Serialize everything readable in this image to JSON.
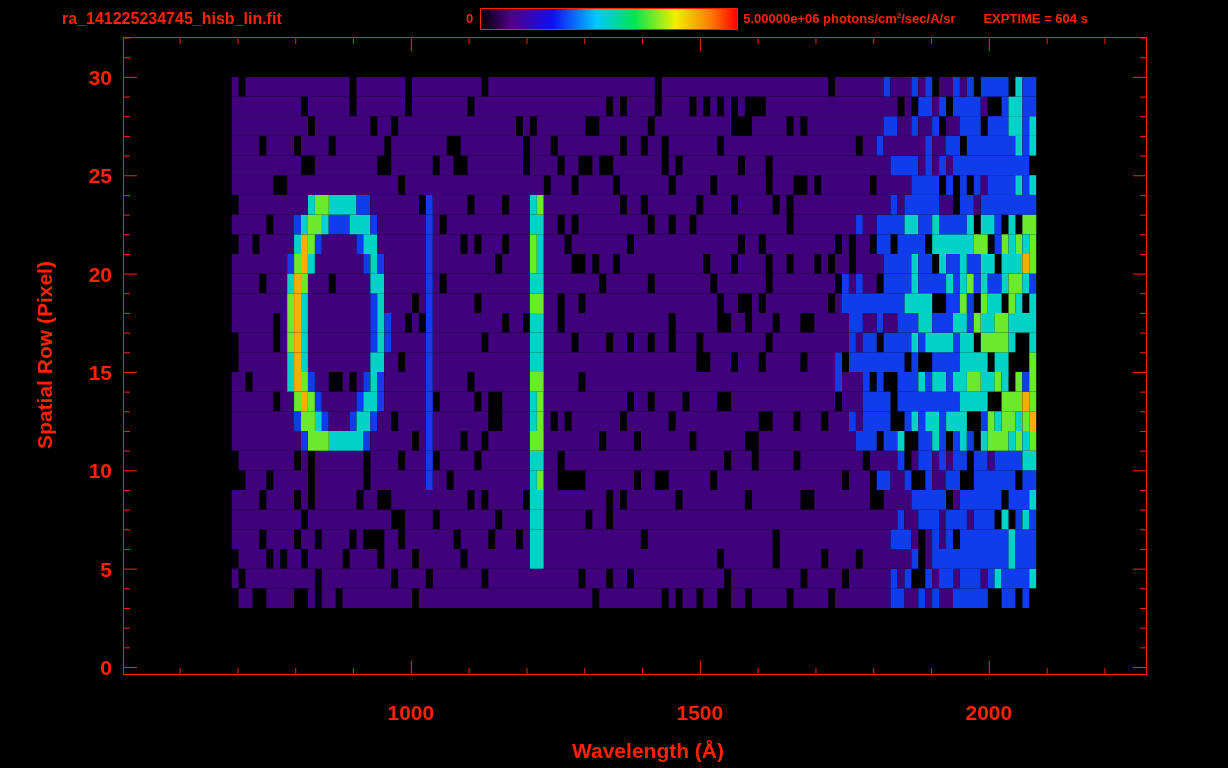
{
  "header": {
    "file_name": "ra_141225234745_hisb_lin.fit",
    "colorbar": {
      "min_label": "0",
      "max_label": "5.00000e+06 photons/cm$^{2}$/sec/A/sr"
    },
    "exposure": "EXPTIME = 604 s"
  },
  "plot": {
    "x_axis": {
      "label": "Wavelength (Å)",
      "ticks": [
        "1000",
        "1500",
        "2000"
      ]
    },
    "y_axis": {
      "label": "Spatial Row (Pixel)",
      "ticks": [
        "30",
        "25",
        "20",
        "15",
        "10",
        "5",
        "0"
      ]
    }
  }
}
